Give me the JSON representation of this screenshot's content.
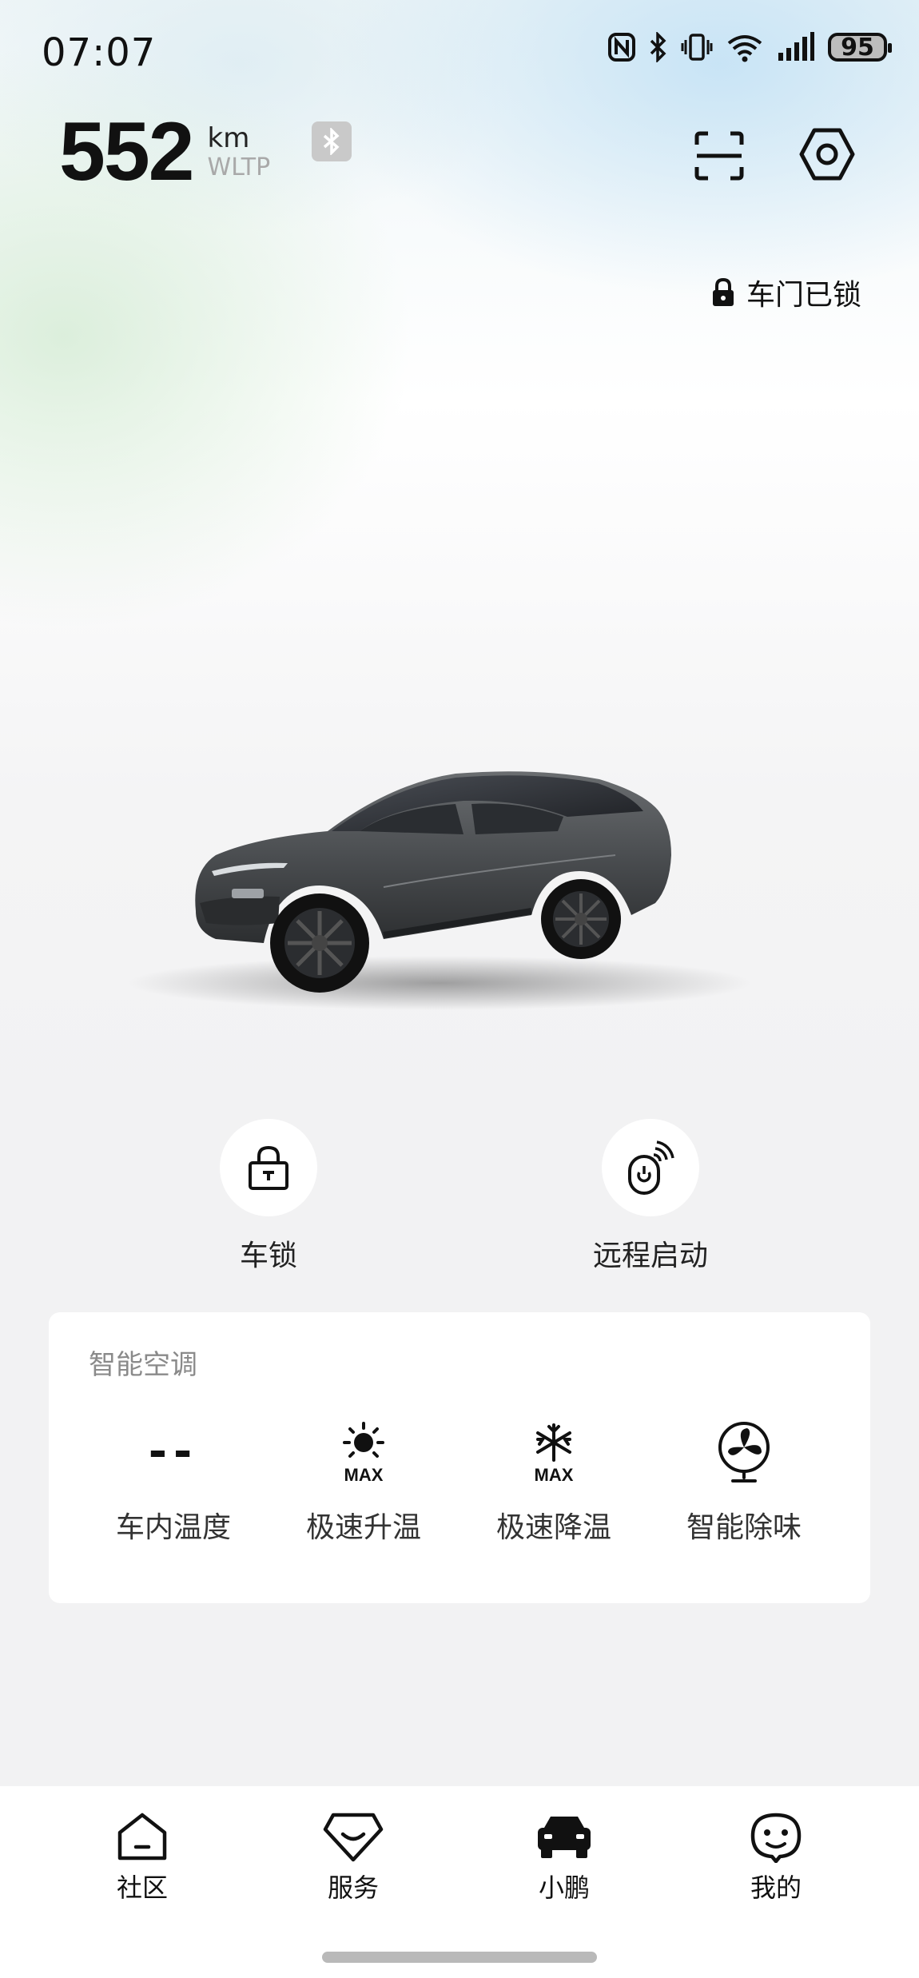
{
  "status_bar": {
    "time": "07:07",
    "battery": "95"
  },
  "range": {
    "value": "552",
    "unit": "km",
    "standard": "WLTP"
  },
  "header": {
    "scan_icon": "scan-icon",
    "settings_icon": "settings-hex-icon",
    "bluetooth_icon": "bluetooth-icon"
  },
  "vehicle_status": {
    "lock_text": "车门已锁",
    "lock_icon": "lock-icon"
  },
  "quick_actions": [
    {
      "label": "车锁",
      "icon": "padlock-icon"
    },
    {
      "label": "远程启动",
      "icon": "remote-start-icon"
    }
  ],
  "climate": {
    "title": "智能空调",
    "items": [
      {
        "label": "车内温度",
        "value": "--"
      },
      {
        "label": "极速升温",
        "icon": "heat-max-icon",
        "badge": "MAX"
      },
      {
        "label": "极速降温",
        "icon": "cool-max-icon",
        "badge": "MAX"
      },
      {
        "label": "智能除味",
        "icon": "fan-icon"
      }
    ]
  },
  "bottom_nav": [
    {
      "label": "社区",
      "icon": "home-icon"
    },
    {
      "label": "服务",
      "icon": "service-icon"
    },
    {
      "label": "小鹏",
      "icon": "car-icon",
      "active": true
    },
    {
      "label": "我的",
      "icon": "profile-icon"
    }
  ]
}
